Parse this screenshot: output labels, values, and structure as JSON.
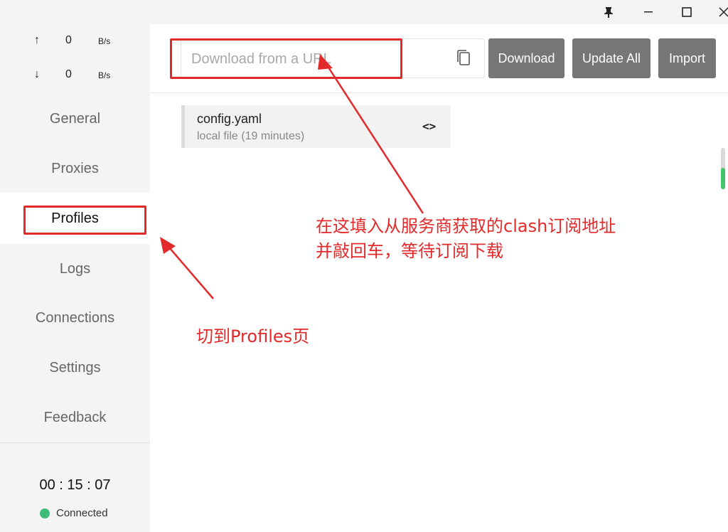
{
  "window": {
    "pin_icon": "pin-icon",
    "minimize_icon": "minimize-icon",
    "maximize_icon": "maximize-icon",
    "close_icon": "close-icon"
  },
  "traffic": {
    "up_arrow": "↑",
    "up_value": "0",
    "up_unit": "B/s",
    "down_arrow": "↓",
    "down_value": "0",
    "down_unit": "B/s"
  },
  "sidebar": {
    "items": [
      {
        "label": "General"
      },
      {
        "label": "Proxies"
      },
      {
        "label": "Profiles"
      },
      {
        "label": "Logs"
      },
      {
        "label": "Connections"
      },
      {
        "label": "Settings"
      },
      {
        "label": "Feedback"
      }
    ],
    "active": "Profiles",
    "timer": "00 : 15 : 07",
    "status": "Connected",
    "status_color": "#3dbb7a"
  },
  "toolbar": {
    "url_placeholder": "Download from a URL",
    "copy_icon": "copy-icon",
    "download_label": "Download",
    "update_all_label": "Update All",
    "import_label": "Import"
  },
  "profiles": [
    {
      "name": "config.yaml",
      "desc": "local file (19 minutes)",
      "icon": "code-icon"
    }
  ],
  "annotations": {
    "color": "#e32a2a",
    "url_note_line1": "在这填入从服务商获取的clash订阅地址",
    "url_note_line2": "并敲回车，等待订阅下载",
    "profiles_note": "切到Profiles页"
  }
}
